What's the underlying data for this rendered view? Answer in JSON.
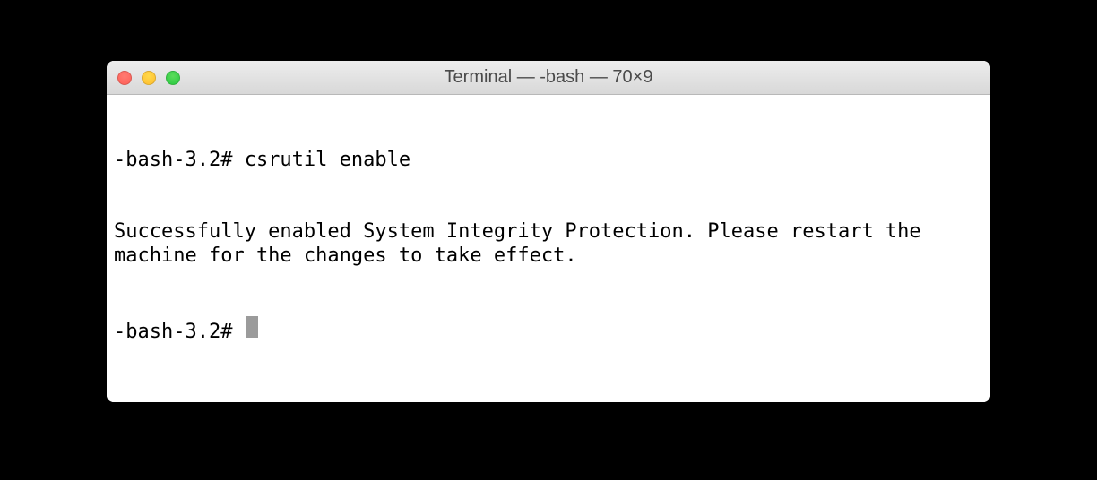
{
  "window": {
    "title": "Terminal — -bash — 70×9"
  },
  "terminal": {
    "lines": [
      "-bash-3.2# csrutil enable",
      "Successfully enabled System Integrity Protection. Please restart the machine for the changes to take effect."
    ],
    "prompt": "-bash-3.2# "
  },
  "colors": {
    "close": "#ff5f57",
    "minimize": "#ffbd2e",
    "zoom": "#28c940"
  }
}
